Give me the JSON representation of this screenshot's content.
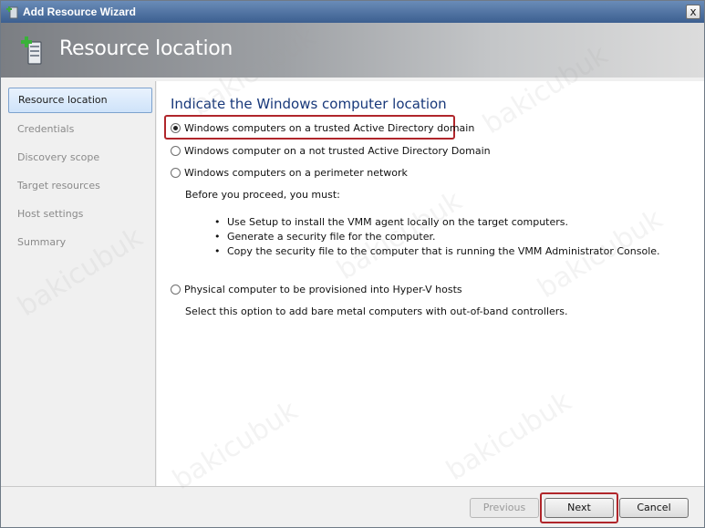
{
  "window": {
    "title": "Add Resource Wizard",
    "close_glyph": "x"
  },
  "banner": {
    "title": "Resource location",
    "icon": "server-add-icon"
  },
  "sidebar": {
    "items": [
      {
        "label": "Resource location",
        "active": true
      },
      {
        "label": "Credentials",
        "active": false
      },
      {
        "label": "Discovery scope",
        "active": false
      },
      {
        "label": "Target resources",
        "active": false
      },
      {
        "label": "Host settings",
        "active": false
      },
      {
        "label": "Summary",
        "active": false
      }
    ]
  },
  "main": {
    "heading": "Indicate the Windows computer location",
    "options": [
      {
        "label": "Windows computers on a trusted Active Directory domain",
        "checked": true
      },
      {
        "label": "Windows computer on a not trusted Active Directory Domain",
        "checked": false
      },
      {
        "label": "Windows computers on a perimeter network",
        "checked": false
      },
      {
        "label": "Physical computer to be provisioned into Hyper-V hosts",
        "checked": false
      }
    ],
    "perimeter_note": "Before you proceed, you must:",
    "perimeter_steps": [
      "Use Setup to install the VMM agent locally on the target computers.",
      "Generate a security file for the computer.",
      "Copy the security file to the computer that is running the VMM Administrator Console."
    ],
    "physical_note": "Select this option to add bare metal computers with out-of-band controllers."
  },
  "footer": {
    "previous_label": "Previous",
    "next_label": "Next",
    "cancel_label": "Cancel"
  },
  "watermark": "bakicubuk",
  "colors": {
    "highlight": "#b0262b",
    "heading": "#17387a",
    "titlebar": "#3c5f90"
  }
}
